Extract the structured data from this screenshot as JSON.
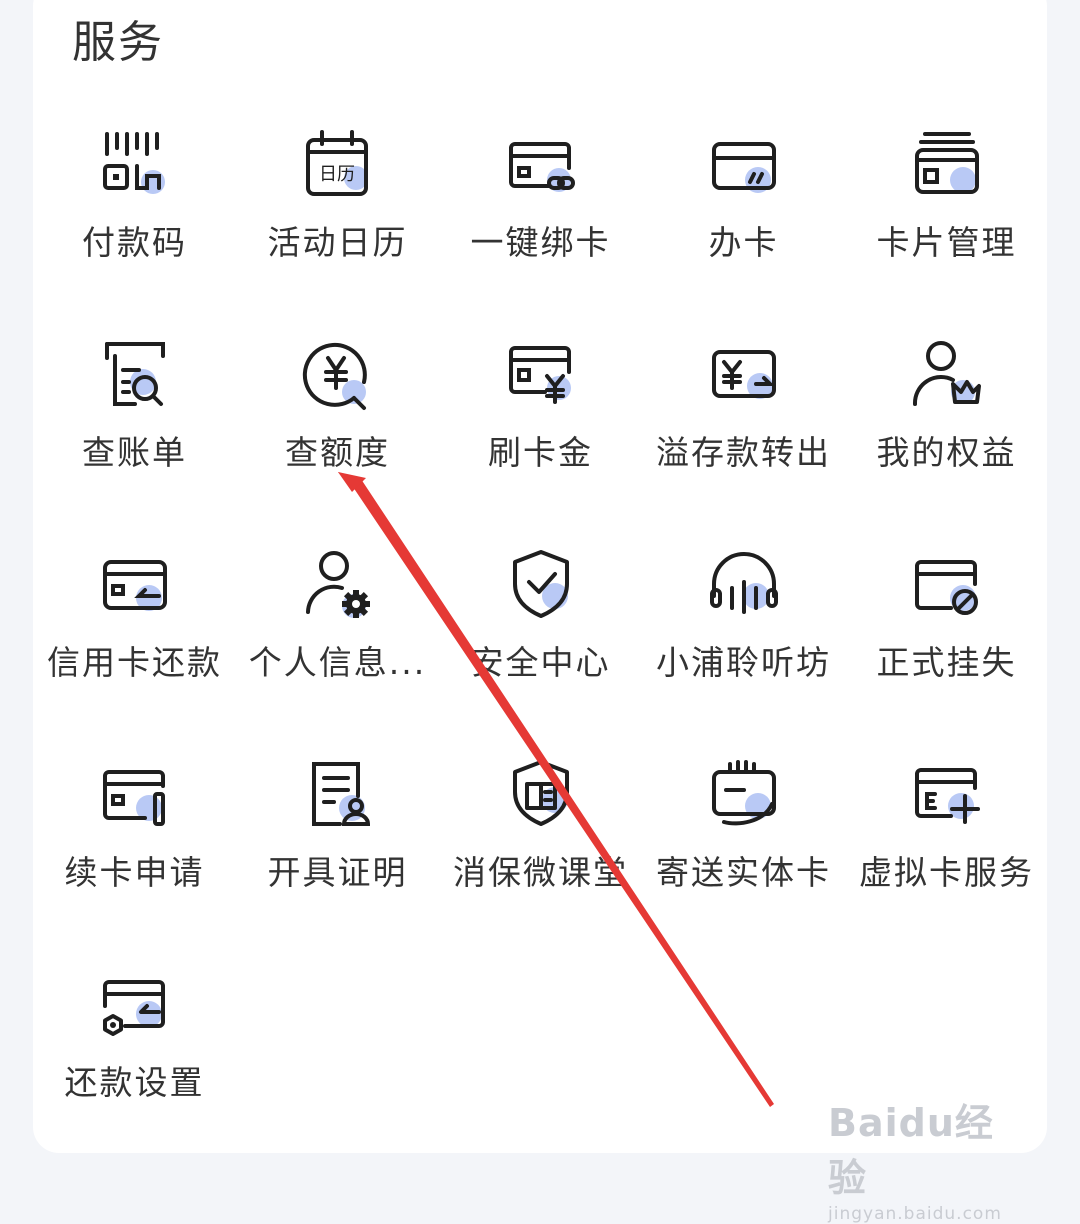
{
  "section": {
    "title": "服务"
  },
  "items": [
    {
      "label": "付款码",
      "icon": "barcode-qr-icon"
    },
    {
      "label": "活动日历",
      "icon": "calendar-icon",
      "icon_text": "日历"
    },
    {
      "label": "一键绑卡",
      "icon": "card-link-icon"
    },
    {
      "label": "办卡",
      "icon": "card-apply-icon"
    },
    {
      "label": "卡片管理",
      "icon": "card-stack-icon"
    },
    {
      "label": "查账单",
      "icon": "bill-search-icon"
    },
    {
      "label": "查额度",
      "icon": "yen-search-icon"
    },
    {
      "label": "刷卡金",
      "icon": "card-yen-icon"
    },
    {
      "label": "溢存款转出",
      "icon": "yen-transfer-icon"
    },
    {
      "label": "我的权益",
      "icon": "user-crown-icon"
    },
    {
      "label": "信用卡还款",
      "icon": "card-repay-icon"
    },
    {
      "label": "个人信息...",
      "icon": "user-gear-icon"
    },
    {
      "label": "安全中心",
      "icon": "shield-check-icon"
    },
    {
      "label": "小浦聆听坊",
      "icon": "headphones-icon"
    },
    {
      "label": "正式挂失",
      "icon": "card-block-icon"
    },
    {
      "label": "续卡申请",
      "icon": "card-renew-icon"
    },
    {
      "label": "开具证明",
      "icon": "document-user-icon"
    },
    {
      "label": "消保微课堂",
      "icon": "shield-book-icon"
    },
    {
      "label": "寄送实体卡",
      "icon": "hand-card-icon"
    },
    {
      "label": "虚拟卡服务",
      "icon": "virtual-card-add-icon"
    },
    {
      "label": "还款设置",
      "icon": "card-settings-icon"
    }
  ],
  "colors": {
    "accent": "#b9c9f5",
    "stroke": "#1f1f1f",
    "arrow": "#e53935"
  },
  "watermark": {
    "logo": "Baidu经验",
    "sub": "jingyan.baidu.com"
  }
}
